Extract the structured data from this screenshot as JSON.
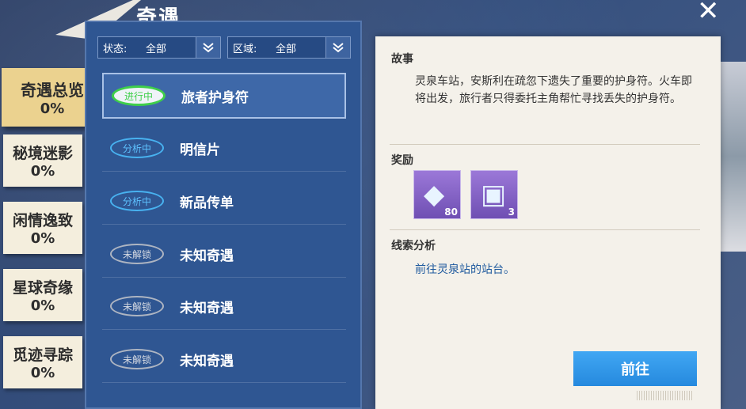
{
  "header": {
    "title": "奇遇",
    "close_icon": "close-icon"
  },
  "tabs": [
    {
      "label": "奇遇总览",
      "value": "0%",
      "active": true
    },
    {
      "label": "秘境迷影",
      "value": "0%"
    },
    {
      "label": "闲情逸致",
      "value": "0%"
    },
    {
      "label": "星球奇缘",
      "value": "0%"
    },
    {
      "label": "觅迹寻踪",
      "value": "0%"
    }
  ],
  "filters": {
    "status": {
      "label": "状态:",
      "value": "全部"
    },
    "region": {
      "label": "区域:",
      "value": "全部"
    }
  },
  "list": [
    {
      "status": "进行中",
      "name": "旅者护身符",
      "selected": true
    },
    {
      "status": "分析中",
      "name": "明信片"
    },
    {
      "status": "分析中",
      "name": "新品传单"
    },
    {
      "status": "未解锁",
      "name": "未知奇遇"
    },
    {
      "status": "未解锁",
      "name": "未知奇遇"
    },
    {
      "status": "未解锁",
      "name": "未知奇遇"
    }
  ],
  "detail": {
    "story_title": "故事",
    "story_text": "灵泉车站，安斯利在疏忽下遗失了重要的护身符。火车即将出发，旅行者只得委托主角帮忙寻找丢失的护身符。",
    "reward_title": "奖励",
    "rewards": [
      {
        "icon": "diamond-icon",
        "count": "80"
      },
      {
        "icon": "case-icon",
        "count": "3"
      }
    ],
    "clue_title": "线索分析",
    "clue_text": "前往灵泉站的站台。",
    "go_label": "前往"
  }
}
